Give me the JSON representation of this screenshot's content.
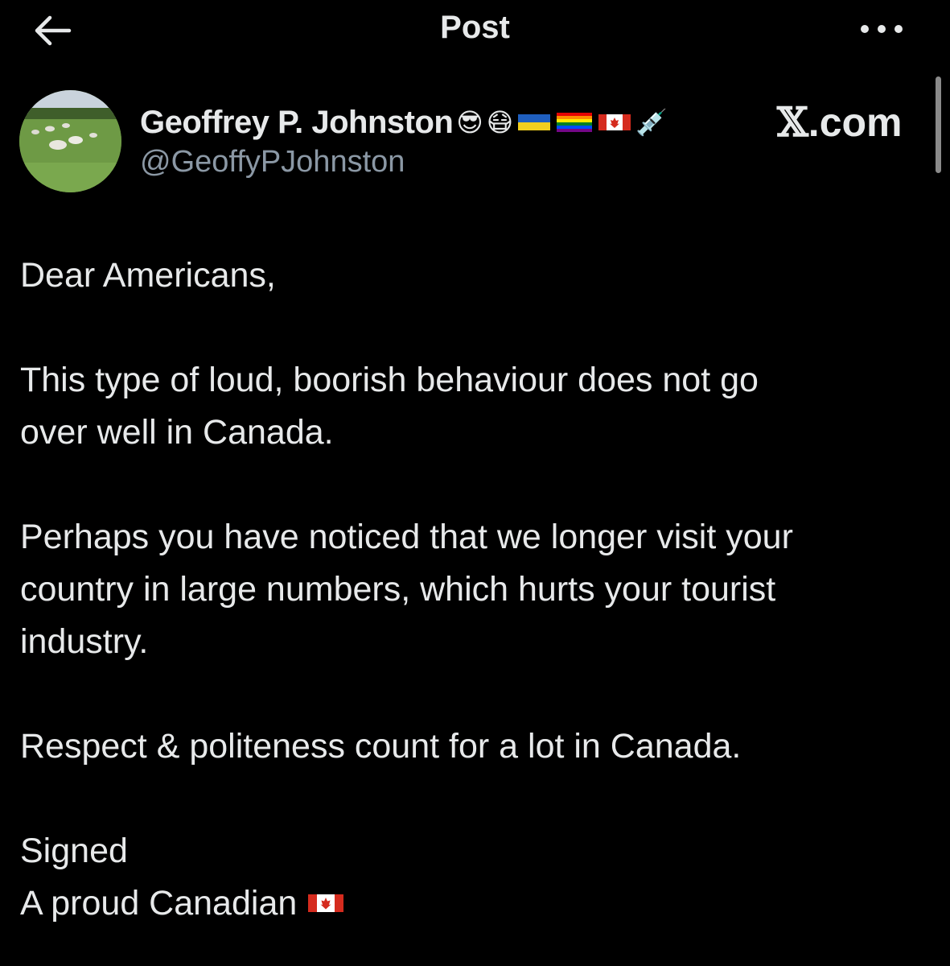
{
  "header": {
    "title": "Post",
    "back_icon": "arrow-left-icon",
    "more_icon": "more-horizontal-icon"
  },
  "author": {
    "display_name": "Geoffrey P. Johnston",
    "name_emojis": [
      "😎",
      "😷",
      "ukraine-flag",
      "rainbow-flag",
      "canada-flag",
      "💉"
    ],
    "handle": "@GeoffyPJohnston",
    "avatar": "sheep-pasture-avatar"
  },
  "brand": {
    "x_mark": "𝕏",
    "suffix": ".com"
  },
  "post": {
    "greeting": "Dear Americans,",
    "paragraph_1_line_1": "This type of loud, boorish behaviour does not go",
    "paragraph_1_line_2": "over well in Canada.",
    "paragraph_2_line_1": "Perhaps you have noticed that we longer visit your",
    "paragraph_2_line_2": "country in large numbers, which hurts your tourist",
    "paragraph_2_line_3": "industry.",
    "paragraph_3": "Respect & politeness count for a lot in Canada.",
    "signed": "Signed",
    "signature": "A proud Canadian",
    "signature_emoji": "canada-flag"
  },
  "colors": {
    "background": "#000000",
    "text": "#e7e9ea",
    "secondary_text": "#8b98a5"
  }
}
